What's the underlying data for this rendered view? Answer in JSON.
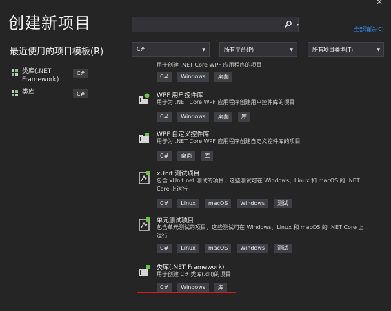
{
  "window": {
    "close_glyph": "✕"
  },
  "page": {
    "title": "创建新项目"
  },
  "recent": {
    "title": "最近使用的项目模板(R)",
    "items": [
      {
        "name": "类库(.NET Framework)",
        "lang": "C#",
        "icon": "class-library-icon"
      },
      {
        "name": "类库",
        "lang": "C#",
        "icon": "class-library-icon"
      }
    ]
  },
  "search": {
    "placeholder": "",
    "value": "",
    "clear_all": "全部清除(C)"
  },
  "filters": {
    "language": "C#",
    "platform": "所有平台(P)",
    "project_type": "所有项目类型(T)"
  },
  "templates": [
    {
      "name": "",
      "desc": "用于创建 .NET Core WPF 应用程序的项目",
      "tags": [
        "C#",
        "Windows",
        "桌面"
      ]
    },
    {
      "name": "WPF 用户控件库",
      "desc": "用于为 .NET Core WPF 应用程序创建用户控件库的项目",
      "tags": [
        "C#",
        "Windows",
        "桌面",
        "库"
      ]
    },
    {
      "name": "WPF 自定义控件库",
      "desc": "用于为 .NET Core WPF 应用程序创建自定义控件库的项目",
      "tags": [
        "C#",
        "桌面",
        "库"
      ]
    },
    {
      "name": "xUnit 测试项目",
      "desc": "包含 xUnit.net 测试的项目，这些测试可在 Windows、Linux 和 macOS 的 .NET Core 上运行",
      "tags": [
        "C#",
        "Linux",
        "macOS",
        "Windows",
        "测试"
      ]
    },
    {
      "name": "单元测试项目",
      "desc": "包含单元测试的项目，这些测试可在 Windows、Linux 和 macOS 的 .NET Core 上运行",
      "tags": [
        "C#",
        "Linux",
        "macOS",
        "Windows",
        "测试"
      ]
    },
    {
      "name": "类库(.NET Framework)",
      "desc": "用于创建 C# 类库(.dll)的项目",
      "tags": [
        "C#",
        "Windows",
        "库"
      ]
    }
  ],
  "colors": {
    "accent": "#3794ff",
    "highlight": "#e0161d",
    "background": "#252526"
  }
}
